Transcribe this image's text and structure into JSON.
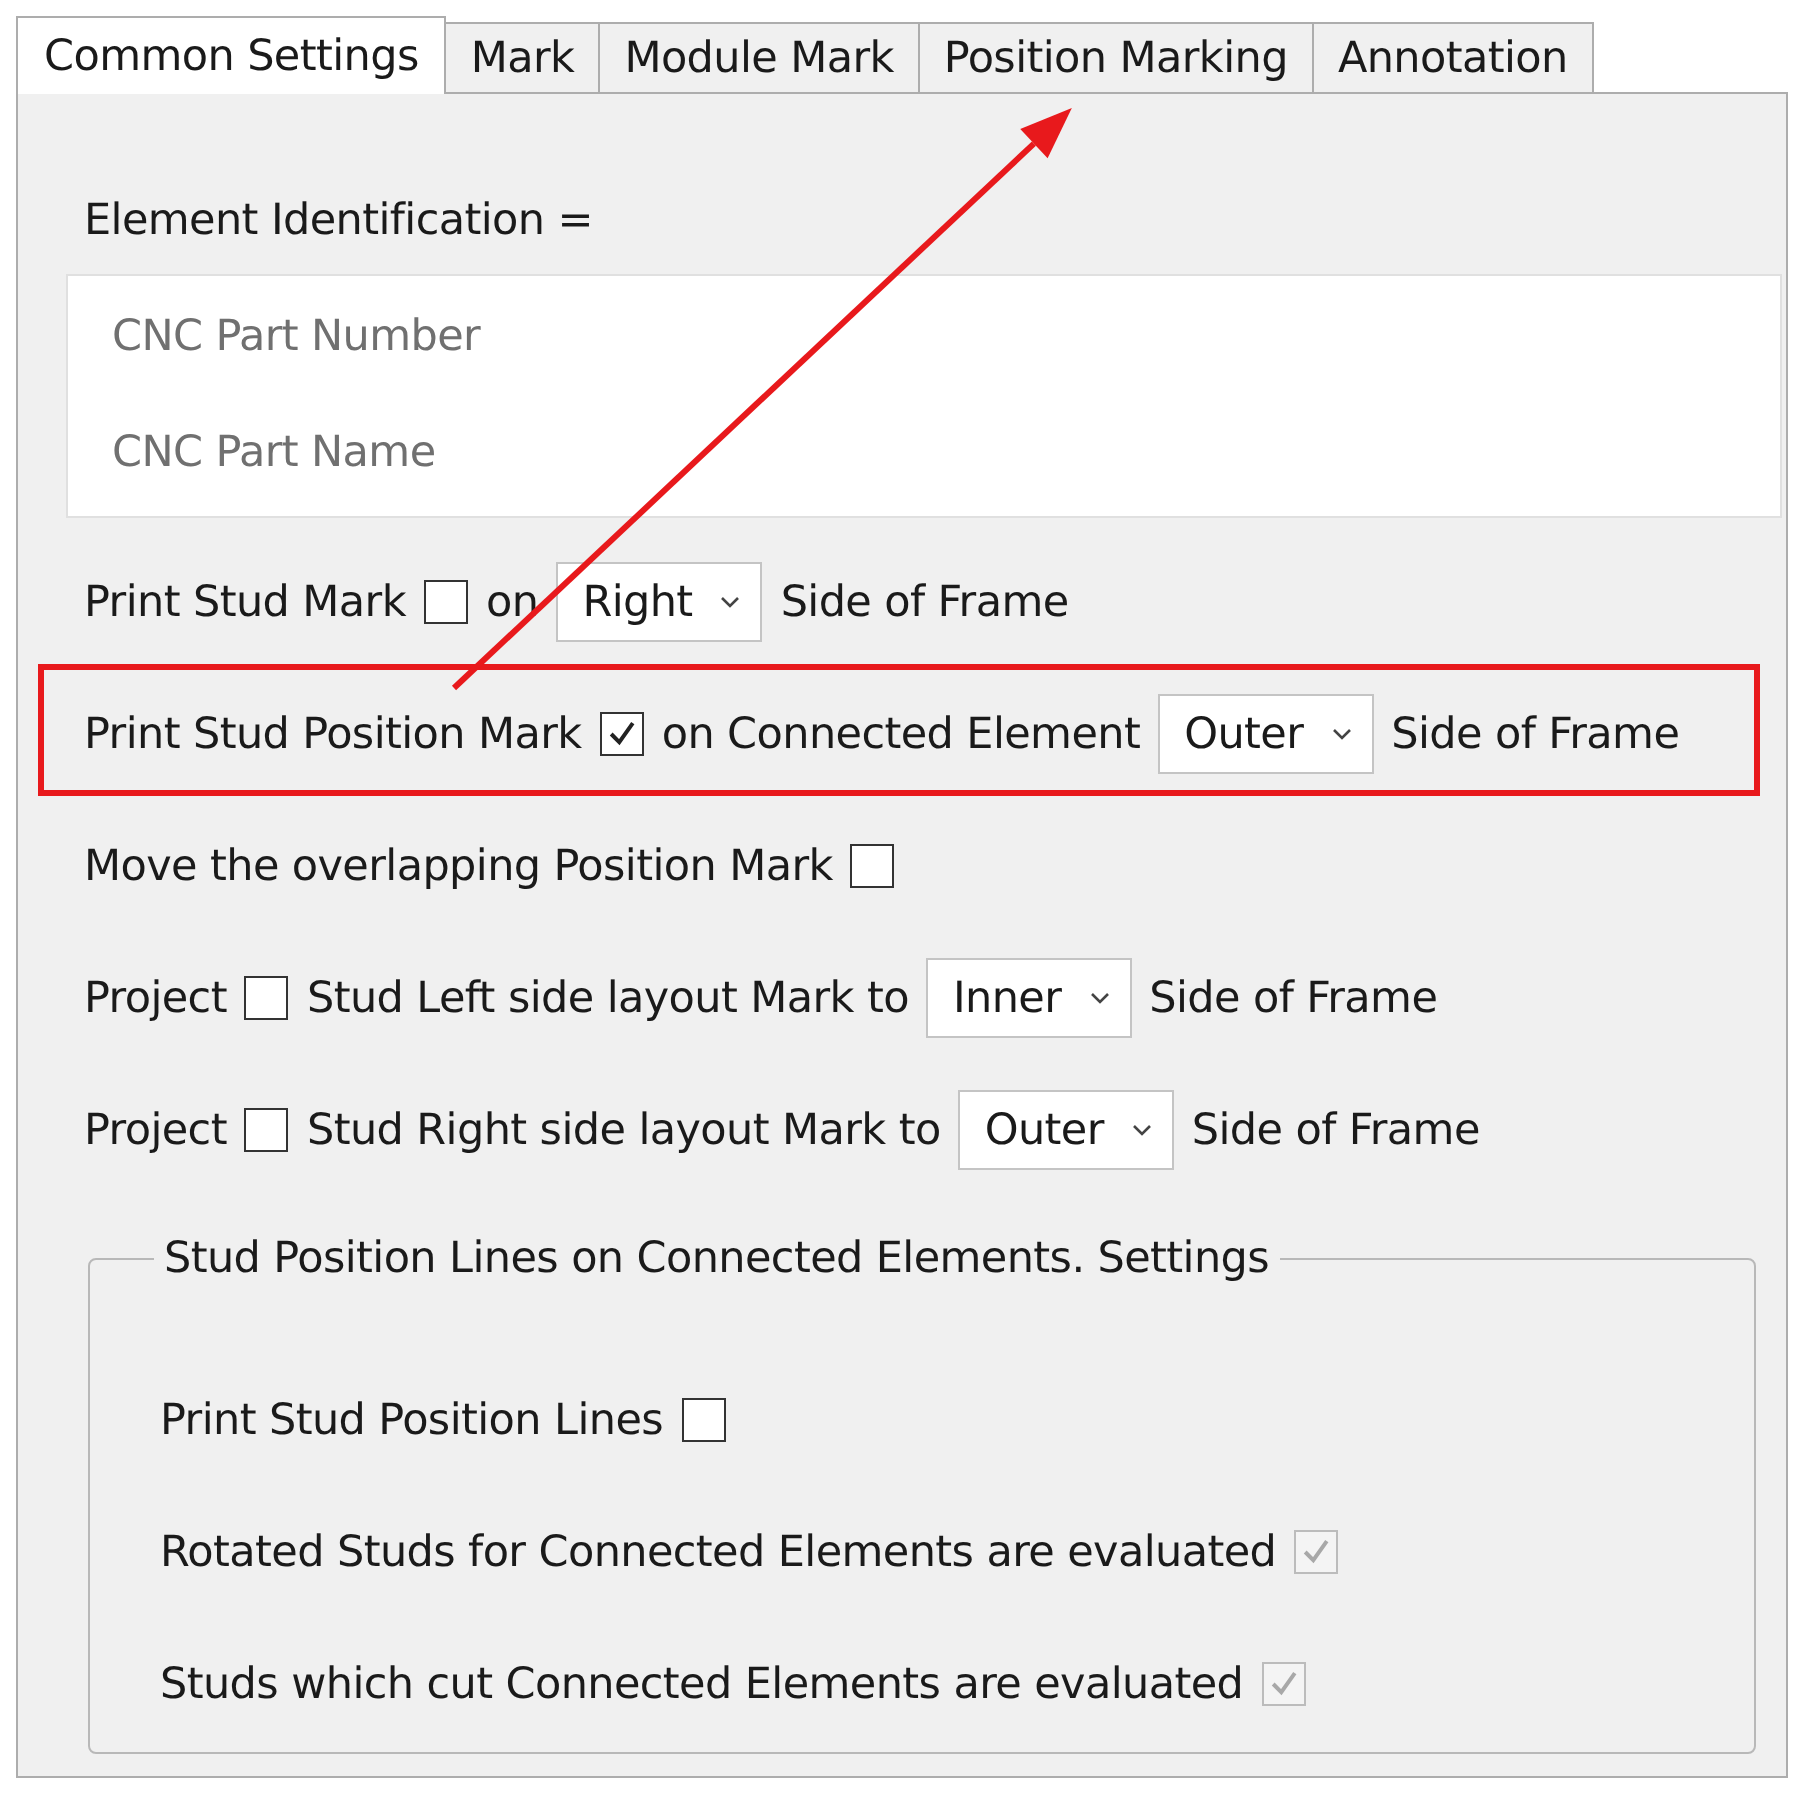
{
  "tabs": [
    {
      "label": "Common Settings",
      "selected": true,
      "pointed": false
    },
    {
      "label": "Mark",
      "selected": false,
      "pointed": false
    },
    {
      "label": "Module Mark",
      "selected": false,
      "pointed": false
    },
    {
      "label": "Position Marking",
      "selected": false,
      "pointed": true
    },
    {
      "label": "Annotation",
      "selected": false,
      "pointed": false
    }
  ],
  "identification": {
    "label": "Element Identification =",
    "items": [
      "CNC Part Number",
      "CNC Part Name"
    ]
  },
  "rows": [
    {
      "parts": [
        {
          "kind": "text",
          "text": "Print Stud Mark"
        },
        {
          "kind": "checkbox",
          "checked": false,
          "disabled": false
        },
        {
          "kind": "text",
          "text": "on"
        },
        {
          "kind": "dropdown",
          "value": "Right"
        },
        {
          "kind": "text",
          "text": "Side of Frame"
        }
      ]
    },
    {
      "highlighted": true,
      "parts": [
        {
          "kind": "text",
          "text": "Print Stud Position Mark"
        },
        {
          "kind": "checkbox",
          "checked": true,
          "disabled": false
        },
        {
          "kind": "text",
          "text": "on Connected Element"
        },
        {
          "kind": "dropdown",
          "value": "Outer"
        },
        {
          "kind": "text",
          "text": "Side of Frame"
        }
      ]
    },
    {
      "parts": [
        {
          "kind": "text",
          "text": "Move the overlapping Position Mark"
        },
        {
          "kind": "checkbox",
          "checked": false,
          "disabled": false
        }
      ]
    },
    {
      "parts": [
        {
          "kind": "text",
          "text": "Project"
        },
        {
          "kind": "checkbox",
          "checked": false,
          "disabled": false
        },
        {
          "kind": "text",
          "text": "Stud Left side layout Mark to"
        },
        {
          "kind": "dropdown",
          "value": "Inner"
        },
        {
          "kind": "text",
          "text": "Side of Frame"
        }
      ]
    },
    {
      "parts": [
        {
          "kind": "text",
          "text": "Project"
        },
        {
          "kind": "checkbox",
          "checked": false,
          "disabled": false
        },
        {
          "kind": "text",
          "text": "Stud Right side layout Mark to"
        },
        {
          "kind": "dropdown",
          "value": "Outer"
        },
        {
          "kind": "text",
          "text": "Side of Frame"
        }
      ]
    }
  ],
  "group": {
    "title": "Stud Position Lines on Connected Elements. Settings",
    "rows": [
      {
        "parts": [
          {
            "kind": "text",
            "text": "Print Stud Position Lines"
          },
          {
            "kind": "checkbox",
            "checked": false,
            "disabled": false
          }
        ]
      },
      {
        "parts": [
          {
            "kind": "text",
            "text": "Rotated Studs for Connected Elements are evaluated"
          },
          {
            "kind": "checkbox",
            "checked": true,
            "disabled": true
          }
        ]
      },
      {
        "parts": [
          {
            "kind": "text",
            "text": "Studs which cut Connected Elements are evaluated"
          },
          {
            "kind": "checkbox",
            "checked": true,
            "disabled": true
          }
        ]
      }
    ]
  }
}
